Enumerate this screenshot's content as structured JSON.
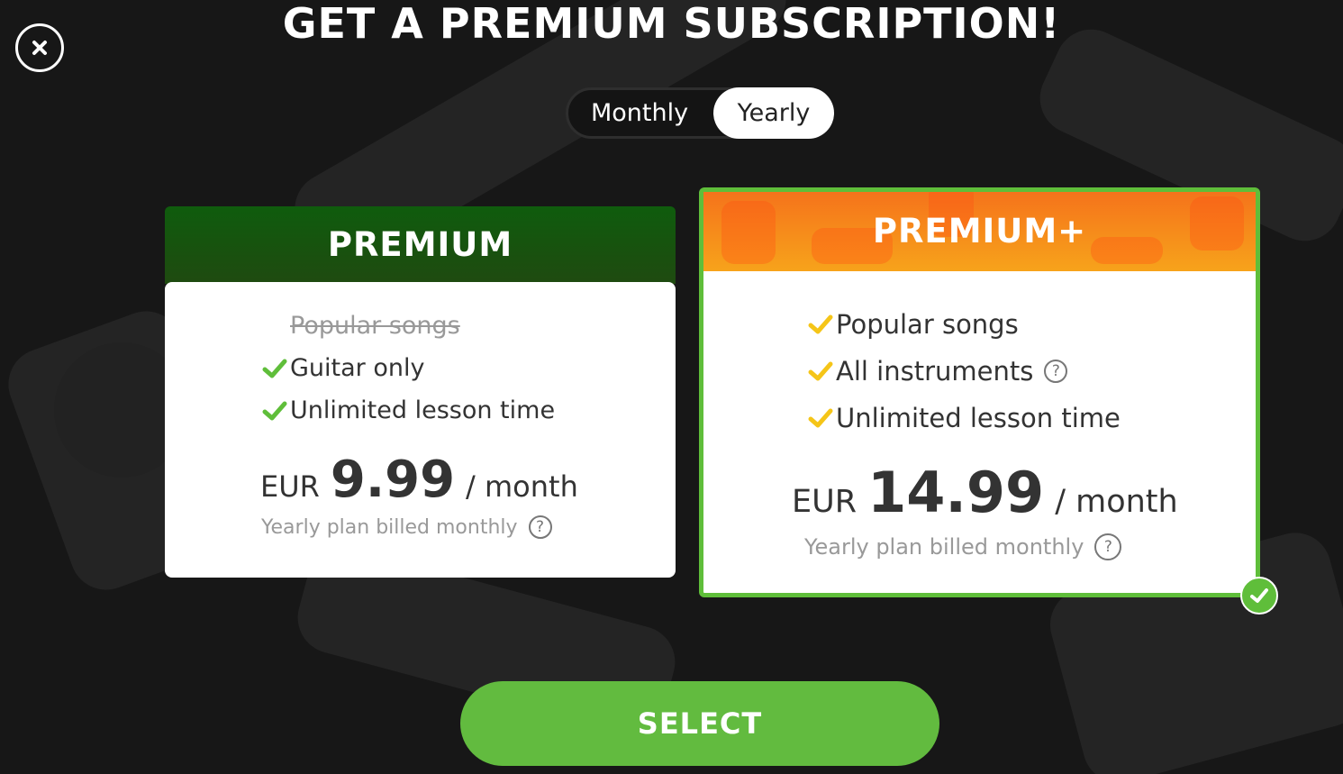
{
  "header": {
    "title": "GET A PREMIUM SUBSCRIPTION!",
    "close_icon": "close-icon"
  },
  "billing_toggle": {
    "options": [
      "Monthly",
      "Yearly"
    ],
    "selected": "Yearly"
  },
  "plans": [
    {
      "name": "PREMIUM",
      "selected": false,
      "features": [
        {
          "label": "Popular songs",
          "included": false
        },
        {
          "label": "Guitar only",
          "included": true
        },
        {
          "label": "Unlimited lesson time",
          "included": true
        }
      ],
      "price": {
        "currency": "EUR",
        "amount": "9.99",
        "period": "/ month"
      },
      "billing_note": "Yearly plan billed monthly"
    },
    {
      "name": "PREMIUM+",
      "selected": true,
      "features": [
        {
          "label": "Popular songs",
          "included": true
        },
        {
          "label": "All instruments",
          "included": true
        },
        {
          "label": "Unlimited lesson time",
          "included": true
        }
      ],
      "price": {
        "currency": "EUR",
        "amount": "14.99",
        "period": "/ month"
      },
      "billing_note": "Yearly plan billed monthly"
    }
  ],
  "cta": {
    "label": "SELECT"
  },
  "colors": {
    "accent_green": "#62bb3f",
    "premium_header": "#0f5c0d",
    "premium_plus_header": "#f7931b",
    "check_green": "#5fbe3a",
    "check_yellow": "#f5c518",
    "background": "#171717"
  }
}
